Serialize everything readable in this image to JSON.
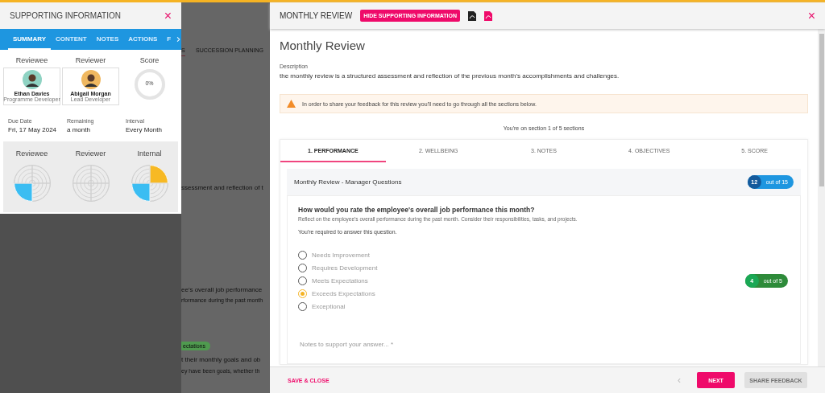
{
  "supporting_panel": {
    "title": "SUPPORTING INFORMATION",
    "close": "×",
    "tabs": [
      {
        "label": "SUMMARY",
        "selected": true
      },
      {
        "label": "CONTENT",
        "selected": false
      },
      {
        "label": "NOTES",
        "selected": false
      },
      {
        "label": "ACTIONS",
        "selected": false
      },
      {
        "label": "F",
        "selected": false
      }
    ],
    "people": [
      {
        "role": "Reviewee",
        "name": "Ethan Davies",
        "job": "Programme Developer",
        "color": "#8fd3c3"
      },
      {
        "role": "Reviewer",
        "name": "Abigail Morgan",
        "job": "Lead Developer",
        "color": "#f0b860"
      }
    ],
    "score": {
      "label": "Score",
      "value": "0%",
      "level": 0
    },
    "facts": [
      {
        "label": "Due Date",
        "value": "Fri, 17 May 2024"
      },
      {
        "label": "Remaining",
        "value": "a month"
      },
      {
        "label": "Interval",
        "value": "Every Month"
      }
    ],
    "radars": [
      {
        "label": "Reviewee",
        "quadrants": [
          {
            "filled": false
          },
          {
            "filled": false
          },
          {
            "filled": true,
            "color": "#3bbdf2"
          },
          {
            "filled": false
          }
        ]
      },
      {
        "label": "Reviewer",
        "quadrants": [
          {
            "filled": false
          },
          {
            "filled": false
          },
          {
            "filled": false
          },
          {
            "filled": false
          }
        ]
      },
      {
        "label": "Internal",
        "quadrants": [
          {
            "filled": true,
            "color": "#f7b924"
          },
          {
            "filled": false
          },
          {
            "filled": true,
            "color": "#3bbdf2"
          },
          {
            "filled": false
          }
        ]
      }
    ]
  },
  "background_page": {
    "tabs": [
      {
        "label": "S",
        "selected": true
      },
      {
        "label": "SUCCESSION PLANNING",
        "selected": false
      }
    ],
    "texts": [
      "ssessment and reflection of t",
      "ee's overall job performance",
      "rformance during the past month",
      "t their monthly goals and ob",
      "ey have been goals, whether th"
    ],
    "badge": "ectations"
  },
  "review": {
    "header": {
      "title": "MONTHLY REVIEW",
      "hide_button": "HIDE SUPPORTING INFORMATION",
      "close": "×"
    },
    "title": "Monthly Review",
    "description_label": "Description",
    "description": "the monthly review is a structured assessment and reflection of the previous month's accomplishments and challenges.",
    "warning": "In order to share your feedback for this review you'll need to go through all the sections below.",
    "progress": "You're on section 1 of 5 sections",
    "sections": [
      {
        "label": "1. PERFORMANCE",
        "selected": true
      },
      {
        "label": "2. WELLBEING",
        "selected": false
      },
      {
        "label": "3. NOTES",
        "selected": false
      },
      {
        "label": "4. OBJECTIVES",
        "selected": false
      },
      {
        "label": "5. SCORE",
        "selected": false
      }
    ],
    "group": {
      "title": "Monthly Review - Manager Questions",
      "count": "12",
      "total": "out of 15"
    },
    "question": {
      "text": "How would you rate the employee's overall job performance this month?",
      "hint": "Reflect on the employee's overall performance during the past month. Consider their responsibilities, tasks, and projects.",
      "required": "You're required to answer this question.",
      "options": [
        {
          "label": "Needs Improvement",
          "selected": false
        },
        {
          "label": "Requires Development",
          "selected": false
        },
        {
          "label": "Meets Expectations",
          "selected": false
        },
        {
          "label": "Exceeds Expectations",
          "selected": true
        },
        {
          "label": "Exceptional",
          "selected": false
        }
      ],
      "score": "4",
      "score_total": "out of 5",
      "notes_placeholder": "Notes to support your answer... *"
    },
    "footer": {
      "save": "SAVE & CLOSE",
      "prev": "‹",
      "next": "NEXT",
      "share": "SHARE FEEDBACK",
      "share_disabled": true
    }
  }
}
